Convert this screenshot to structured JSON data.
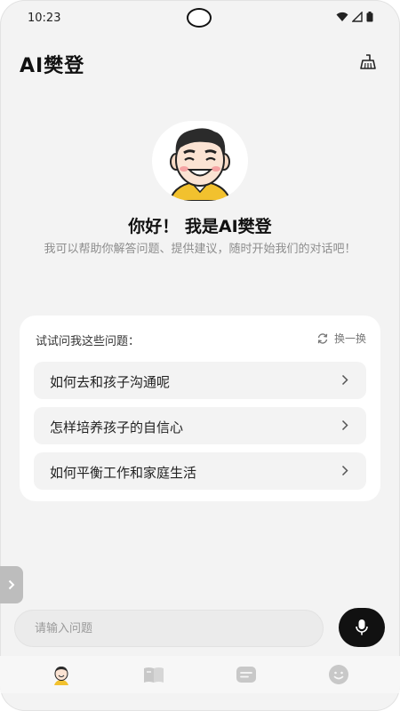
{
  "status_bar": {
    "time": "10:23",
    "icons": [
      "wifi-icon",
      "signal-icon",
      "battery-icon"
    ]
  },
  "header": {
    "title": "AI樊登",
    "clear_icon": "broom-icon"
  },
  "hero": {
    "avatar_icon": "avatar-cartoon",
    "greeting": "你好！ 我是AI樊登",
    "intro": "我可以帮助你解答问题、提供建议，随时开始我们的对话吧！"
  },
  "suggestions": {
    "title": "试试问我这些问题：",
    "refresh_label": "换一换",
    "items": [
      {
        "label": "如何去和孩子沟通呢"
      },
      {
        "label": "怎样培养孩子的自信心"
      },
      {
        "label": "如何平衡工作和家庭生活"
      }
    ]
  },
  "input": {
    "placeholder": "请输入问题",
    "value": ""
  },
  "bottom_nav": {
    "items": [
      "avatar-icon",
      "book-icon",
      "chat-icon",
      "smile-icon"
    ]
  },
  "colors": {
    "background": "#f3f3f3",
    "card": "#ffffff",
    "accent_dark": "#111111",
    "muted_text": "#8d8d8d"
  }
}
